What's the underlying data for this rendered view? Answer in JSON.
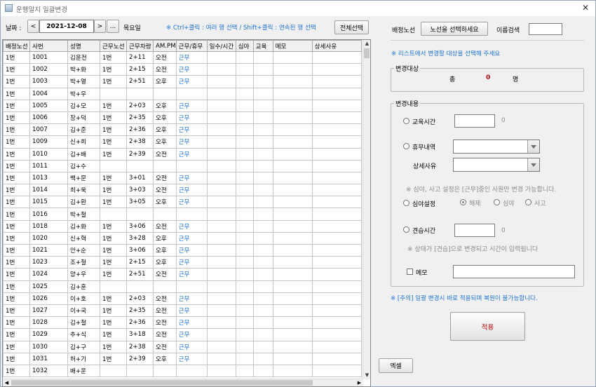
{
  "window": {
    "title": "운행일지 일괄변경",
    "close": "✕"
  },
  "toolbar": {
    "date_label": "날짜 :",
    "prev": "<",
    "date_value": "2021-12-08",
    "next": ">",
    "more": "...",
    "weekday": "목요일",
    "hint": "※ Ctrl+클릭 : 여러 행 선택 / Shift+클릭 : 연속된 행 선택",
    "select_all": "전체선택"
  },
  "grid": {
    "columns": [
      "배정노선",
      "사번",
      "성명",
      "근무노선",
      "근무차량",
      "AM.PM",
      "근무/휴무",
      "일수/시간",
      "심야",
      "교육",
      "메모",
      "상세사유"
    ],
    "rows": [
      [
        "1번",
        "1001",
        "김윤전",
        "1번",
        "2+11",
        "오전",
        "근무"
      ],
      [
        "1번",
        "1002",
        "박+화",
        "1번",
        "2+15",
        "오전",
        "근무"
      ],
      [
        "1번",
        "1003",
        "박+열",
        "1번",
        "2+51",
        "오후",
        "근무"
      ],
      [
        "1번",
        "1004",
        "박+우",
        "",
        "",
        "",
        ""
      ],
      [
        "1번",
        "1005",
        "김+모",
        "1번",
        "2+03",
        "오후",
        "근무"
      ],
      [
        "1번",
        "1006",
        "장+덕",
        "1번",
        "2+35",
        "오후",
        "근무"
      ],
      [
        "1번",
        "1007",
        "김+준",
        "1번",
        "2+36",
        "오후",
        "근무"
      ],
      [
        "1번",
        "1009",
        "신+희",
        "1번",
        "2+38",
        "오후",
        "근무"
      ],
      [
        "1번",
        "1010",
        "김+배",
        "1번",
        "2+39",
        "오전",
        "근무"
      ],
      [
        "1번",
        "1011",
        "김+수",
        "",
        "",
        "",
        ""
      ],
      [
        "1번",
        "1013",
        "백+문",
        "1번",
        "3+01",
        "오전",
        "근무"
      ],
      [
        "1번",
        "1014",
        "최+욱",
        "1번",
        "3+03",
        "오전",
        "근무"
      ],
      [
        "1번",
        "1015",
        "김+환",
        "1번",
        "3+05",
        "오후",
        "근무"
      ],
      [
        "1번",
        "1016",
        "박+철",
        "",
        "",
        "",
        ""
      ],
      [
        "1번",
        "1018",
        "김+화",
        "1번",
        "3+06",
        "오전",
        "근무"
      ],
      [
        "1번",
        "1020",
        "신+혁",
        "1번",
        "3+28",
        "오후",
        "근무"
      ],
      [
        "1번",
        "1021",
        "안+순",
        "1번",
        "3+06",
        "오후",
        "근무"
      ],
      [
        "1번",
        "1023",
        "조+철",
        "1번",
        "2+15",
        "오후",
        "근무"
      ],
      [
        "1번",
        "1024",
        "양+우",
        "1번",
        "2+51",
        "오전",
        "근무"
      ],
      [
        "1번",
        "1025",
        "김+훈",
        "",
        "",
        "",
        ""
      ],
      [
        "1번",
        "1026",
        "이+호",
        "1번",
        "2+03",
        "오전",
        "근무"
      ],
      [
        "1번",
        "1027",
        "이+국",
        "1번",
        "2+35",
        "오전",
        "근무"
      ],
      [
        "1번",
        "1028",
        "김+철",
        "1번",
        "2+36",
        "오전",
        "근무"
      ],
      [
        "1번",
        "1029",
        "추+식",
        "1번",
        "3+18",
        "오전",
        "근무"
      ],
      [
        "1번",
        "1030",
        "김+구",
        "1번",
        "2+38",
        "오전",
        "근무"
      ],
      [
        "1번",
        "1031",
        "허+기",
        "1번",
        "2+39",
        "오후",
        "근무"
      ],
      [
        "1번",
        "1032",
        "배+운",
        "",
        "",
        "",
        ""
      ]
    ]
  },
  "right": {
    "route_label": "배정노선",
    "route_button": "노선을 선택하세요",
    "name_search_label": "이름검색",
    "hint_select": "※ 리스트에서 변경할 대상을 선택해 주세요",
    "target_group": "변경대상",
    "total_label": "총",
    "total_count": "0",
    "unit": "명",
    "change_group": "변경내용",
    "edu_label": "교육시간",
    "edu_value": "0",
    "leave_label": "휴무내역",
    "detail_label": "상세사유",
    "night_note": "※ 심야, 사고 설정은 [근무]중인 사원만 변경 가능합니다.",
    "night_label": "심야설정",
    "night_options": [
      "해제",
      "심야",
      "사고"
    ],
    "trainee_label": "견습시간",
    "trainee_value": "0",
    "trainee_note": "※ 상태가 [견습]으로 변경되고 시간이 입력됩니다",
    "memo_label": "메모",
    "warning": "※ [주의] 일괄 변경시 바로 적용되며 복원이 불가능합니다.",
    "apply": "적용",
    "excel": "엑셀"
  }
}
